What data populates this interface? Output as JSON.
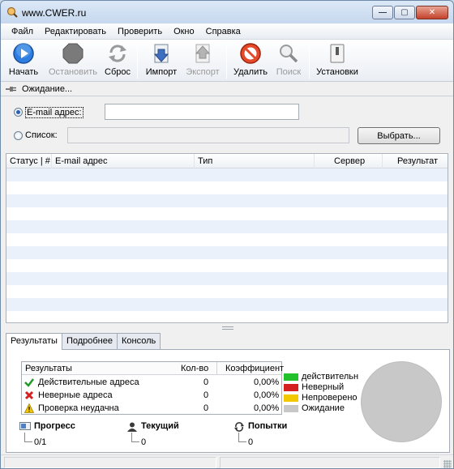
{
  "window": {
    "title": "www.CWER.ru"
  },
  "menu": [
    "Файл",
    "Редактировать",
    "Проверить",
    "Окно",
    "Справка"
  ],
  "toolbar": {
    "start": "Начать",
    "stop": "Остановить",
    "reset": "Сброс",
    "import": "Импорт",
    "export": "Экспорт",
    "delete": "Удалить",
    "search": "Поиск",
    "settings": "Установки"
  },
  "status_strip": {
    "text": "Ожидание..."
  },
  "form": {
    "email_label": "E-mail адрес:",
    "email_value": "",
    "list_label": "Список:",
    "list_value": "",
    "choose_button": "Выбрать..."
  },
  "grid": {
    "columns": [
      "Статус | #",
      "E-mail адрес",
      "Тип",
      "Сервер",
      "Результат"
    ]
  },
  "tabs": [
    "Результаты",
    "Подробнее",
    "Консоль"
  ],
  "results": {
    "headers": [
      "Результаты",
      "Кол-во",
      "Коэффициент"
    ],
    "rows": [
      {
        "icon": "check-icon",
        "label": "Действительные адреса",
        "count": "0",
        "ratio": "0,00%"
      },
      {
        "icon": "cross-icon",
        "label": "Неверные адреса",
        "count": "0",
        "ratio": "0,00%"
      },
      {
        "icon": "warning-icon",
        "label": "Проверка неудачна",
        "count": "0",
        "ratio": "0,00%"
      }
    ]
  },
  "legend": [
    {
      "label": "действительн",
      "color": "#22c02a"
    },
    {
      "label": "Неверный",
      "color": "#d42020"
    },
    {
      "label": "Непроверено",
      "color": "#f2c800"
    },
    {
      "label": "Ожидание",
      "color": "#c8c8c8"
    }
  ],
  "stats": {
    "progress_title": "Прогресс",
    "progress_value": "0/1",
    "current_title": "Текущий",
    "current_value": "0",
    "attempts_title": "Попытки",
    "attempts_value": "0"
  },
  "colors": {
    "accent": "#2a5fb3",
    "pie": "#c8c8c8"
  }
}
